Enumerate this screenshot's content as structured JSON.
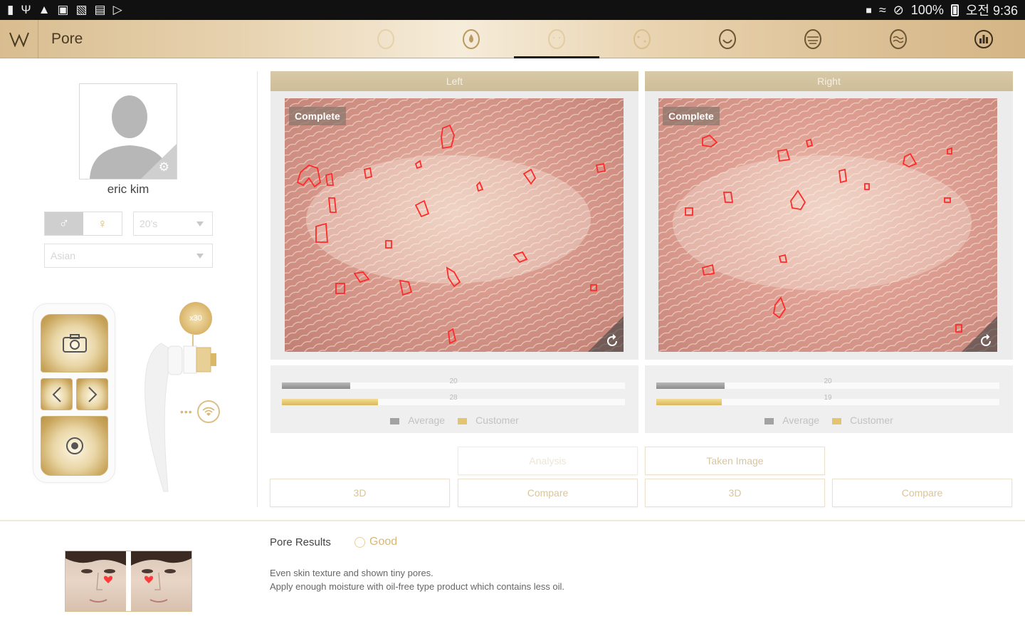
{
  "status_bar": {
    "battery": "100%",
    "time": "오전 9:36"
  },
  "header": {
    "title": "Pore",
    "tabs": [
      {
        "name": "moisture",
        "icon": "face-outline-icon",
        "active": false
      },
      {
        "name": "oil",
        "icon": "drop-icon",
        "active": false
      },
      {
        "name": "pore",
        "icon": "face-pore-icon",
        "active": true
      },
      {
        "name": "spot",
        "icon": "face-spot-icon",
        "active": false
      },
      {
        "name": "wrinkle",
        "icon": "face-wrinkle-icon",
        "active": false
      },
      {
        "name": "keratin",
        "icon": "face-keratin-icon",
        "active": false
      },
      {
        "name": "sensitivity",
        "icon": "face-sensitive-icon",
        "active": false
      },
      {
        "name": "summary",
        "icon": "chart-icon",
        "active": false
      }
    ]
  },
  "profile": {
    "name": "eric kim",
    "age": "20's",
    "ethnicity": "Asian",
    "gender_selected": "male"
  },
  "device": {
    "zoom": "x30"
  },
  "panels": {
    "left": {
      "title": "Left",
      "status": "Complete",
      "average_value": 20,
      "customer_value": 28,
      "average_fraction": 0.2,
      "customer_fraction": 0.28
    },
    "right": {
      "title": "Right",
      "status": "Complete",
      "average_value": 20,
      "customer_value": 19,
      "average_fraction": 0.2,
      "customer_fraction": 0.19
    },
    "legend_average": "Average",
    "legend_customer": "Customer"
  },
  "actions": {
    "analysis": "Analysis",
    "taken_image": "Taken Image",
    "left_3d": "3D",
    "left_compare": "Compare",
    "right_3d": "3D",
    "right_compare": "Compare"
  },
  "results": {
    "title": "Pore Results",
    "grade": "Good",
    "line1": "Even skin texture and shown tiny pores.",
    "line2": "Apply enough moisture with oil-free type product which contains less oil."
  },
  "colors": {
    "accent_gold": "#d8b877",
    "pore_outline": "#ff2a2a",
    "panel_header": "#d3c4a1"
  }
}
